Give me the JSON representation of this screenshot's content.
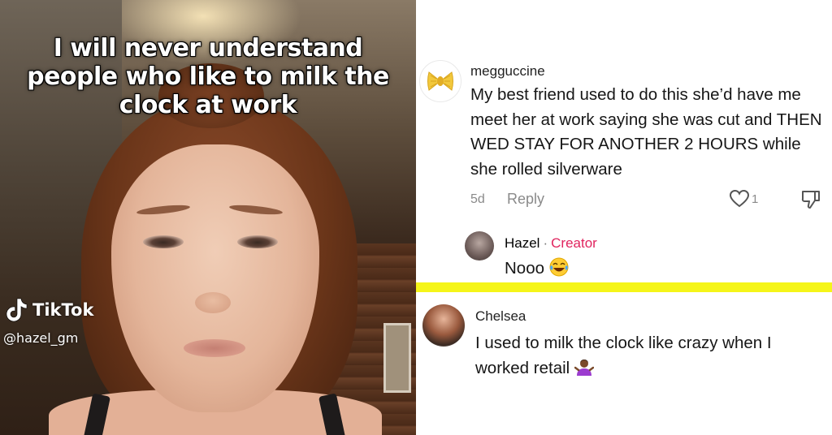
{
  "video": {
    "caption": "I will never understand people who like to milk the clock at work",
    "watermark_brand": "TikTok",
    "watermark_handle": "@hazel_gm"
  },
  "comments": {
    "thread": [
      {
        "username": "megguccine",
        "text": "My best friend used to do this she’d have me meet her at work saying she was cut and THEN WED STAY FOR ANOTHER 2 HOURS while she rolled silverware",
        "time": "5d",
        "reply_label": "Reply",
        "like_count": "1"
      },
      {
        "username": "Hazel",
        "separator": "·",
        "badge": "Creator",
        "text": "Nooo",
        "emoji": "laughing-crying"
      }
    ],
    "second": {
      "username": "Chelsea",
      "text": "I used to milk the clock like crazy when I worked retail",
      "emoji": "person-shrugging"
    }
  },
  "colors": {
    "creator_badge": "#e0245e",
    "divider": "#f5f519",
    "meta_gray": "#8a8a8a"
  }
}
